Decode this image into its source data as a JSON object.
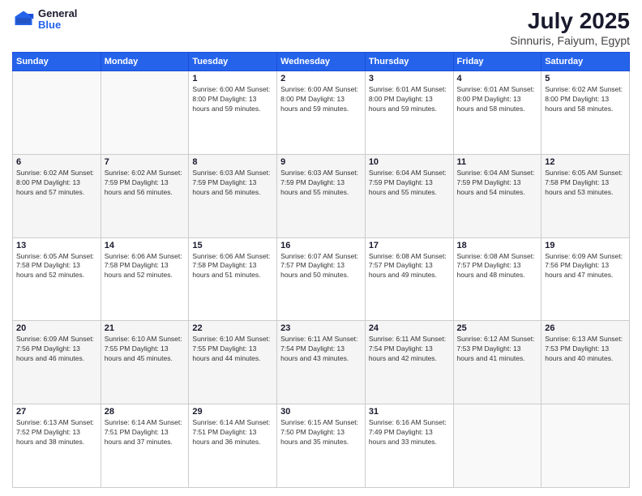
{
  "header": {
    "logo": {
      "general": "General",
      "blue": "Blue"
    },
    "title": "July 2025",
    "subtitle": "Sinnuris, Faiyum, Egypt"
  },
  "calendar": {
    "days_of_week": [
      "Sunday",
      "Monday",
      "Tuesday",
      "Wednesday",
      "Thursday",
      "Friday",
      "Saturday"
    ],
    "weeks": [
      [
        {
          "day": "",
          "detail": ""
        },
        {
          "day": "",
          "detail": ""
        },
        {
          "day": "1",
          "detail": "Sunrise: 6:00 AM\nSunset: 8:00 PM\nDaylight: 13 hours\nand 59 minutes."
        },
        {
          "day": "2",
          "detail": "Sunrise: 6:00 AM\nSunset: 8:00 PM\nDaylight: 13 hours\nand 59 minutes."
        },
        {
          "day": "3",
          "detail": "Sunrise: 6:01 AM\nSunset: 8:00 PM\nDaylight: 13 hours\nand 59 minutes."
        },
        {
          "day": "4",
          "detail": "Sunrise: 6:01 AM\nSunset: 8:00 PM\nDaylight: 13 hours\nand 58 minutes."
        },
        {
          "day": "5",
          "detail": "Sunrise: 6:02 AM\nSunset: 8:00 PM\nDaylight: 13 hours\nand 58 minutes."
        }
      ],
      [
        {
          "day": "6",
          "detail": "Sunrise: 6:02 AM\nSunset: 8:00 PM\nDaylight: 13 hours\nand 57 minutes."
        },
        {
          "day": "7",
          "detail": "Sunrise: 6:02 AM\nSunset: 7:59 PM\nDaylight: 13 hours\nand 56 minutes."
        },
        {
          "day": "8",
          "detail": "Sunrise: 6:03 AM\nSunset: 7:59 PM\nDaylight: 13 hours\nand 56 minutes."
        },
        {
          "day": "9",
          "detail": "Sunrise: 6:03 AM\nSunset: 7:59 PM\nDaylight: 13 hours\nand 55 minutes."
        },
        {
          "day": "10",
          "detail": "Sunrise: 6:04 AM\nSunset: 7:59 PM\nDaylight: 13 hours\nand 55 minutes."
        },
        {
          "day": "11",
          "detail": "Sunrise: 6:04 AM\nSunset: 7:59 PM\nDaylight: 13 hours\nand 54 minutes."
        },
        {
          "day": "12",
          "detail": "Sunrise: 6:05 AM\nSunset: 7:58 PM\nDaylight: 13 hours\nand 53 minutes."
        }
      ],
      [
        {
          "day": "13",
          "detail": "Sunrise: 6:05 AM\nSunset: 7:58 PM\nDaylight: 13 hours\nand 52 minutes."
        },
        {
          "day": "14",
          "detail": "Sunrise: 6:06 AM\nSunset: 7:58 PM\nDaylight: 13 hours\nand 52 minutes."
        },
        {
          "day": "15",
          "detail": "Sunrise: 6:06 AM\nSunset: 7:58 PM\nDaylight: 13 hours\nand 51 minutes."
        },
        {
          "day": "16",
          "detail": "Sunrise: 6:07 AM\nSunset: 7:57 PM\nDaylight: 13 hours\nand 50 minutes."
        },
        {
          "day": "17",
          "detail": "Sunrise: 6:08 AM\nSunset: 7:57 PM\nDaylight: 13 hours\nand 49 minutes."
        },
        {
          "day": "18",
          "detail": "Sunrise: 6:08 AM\nSunset: 7:57 PM\nDaylight: 13 hours\nand 48 minutes."
        },
        {
          "day": "19",
          "detail": "Sunrise: 6:09 AM\nSunset: 7:56 PM\nDaylight: 13 hours\nand 47 minutes."
        }
      ],
      [
        {
          "day": "20",
          "detail": "Sunrise: 6:09 AM\nSunset: 7:56 PM\nDaylight: 13 hours\nand 46 minutes."
        },
        {
          "day": "21",
          "detail": "Sunrise: 6:10 AM\nSunset: 7:55 PM\nDaylight: 13 hours\nand 45 minutes."
        },
        {
          "day": "22",
          "detail": "Sunrise: 6:10 AM\nSunset: 7:55 PM\nDaylight: 13 hours\nand 44 minutes."
        },
        {
          "day": "23",
          "detail": "Sunrise: 6:11 AM\nSunset: 7:54 PM\nDaylight: 13 hours\nand 43 minutes."
        },
        {
          "day": "24",
          "detail": "Sunrise: 6:11 AM\nSunset: 7:54 PM\nDaylight: 13 hours\nand 42 minutes."
        },
        {
          "day": "25",
          "detail": "Sunrise: 6:12 AM\nSunset: 7:53 PM\nDaylight: 13 hours\nand 41 minutes."
        },
        {
          "day": "26",
          "detail": "Sunrise: 6:13 AM\nSunset: 7:53 PM\nDaylight: 13 hours\nand 40 minutes."
        }
      ],
      [
        {
          "day": "27",
          "detail": "Sunrise: 6:13 AM\nSunset: 7:52 PM\nDaylight: 13 hours\nand 38 minutes."
        },
        {
          "day": "28",
          "detail": "Sunrise: 6:14 AM\nSunset: 7:51 PM\nDaylight: 13 hours\nand 37 minutes."
        },
        {
          "day": "29",
          "detail": "Sunrise: 6:14 AM\nSunset: 7:51 PM\nDaylight: 13 hours\nand 36 minutes."
        },
        {
          "day": "30",
          "detail": "Sunrise: 6:15 AM\nSunset: 7:50 PM\nDaylight: 13 hours\nand 35 minutes."
        },
        {
          "day": "31",
          "detail": "Sunrise: 6:16 AM\nSunset: 7:49 PM\nDaylight: 13 hours\nand 33 minutes."
        },
        {
          "day": "",
          "detail": ""
        },
        {
          "day": "",
          "detail": ""
        }
      ]
    ]
  }
}
